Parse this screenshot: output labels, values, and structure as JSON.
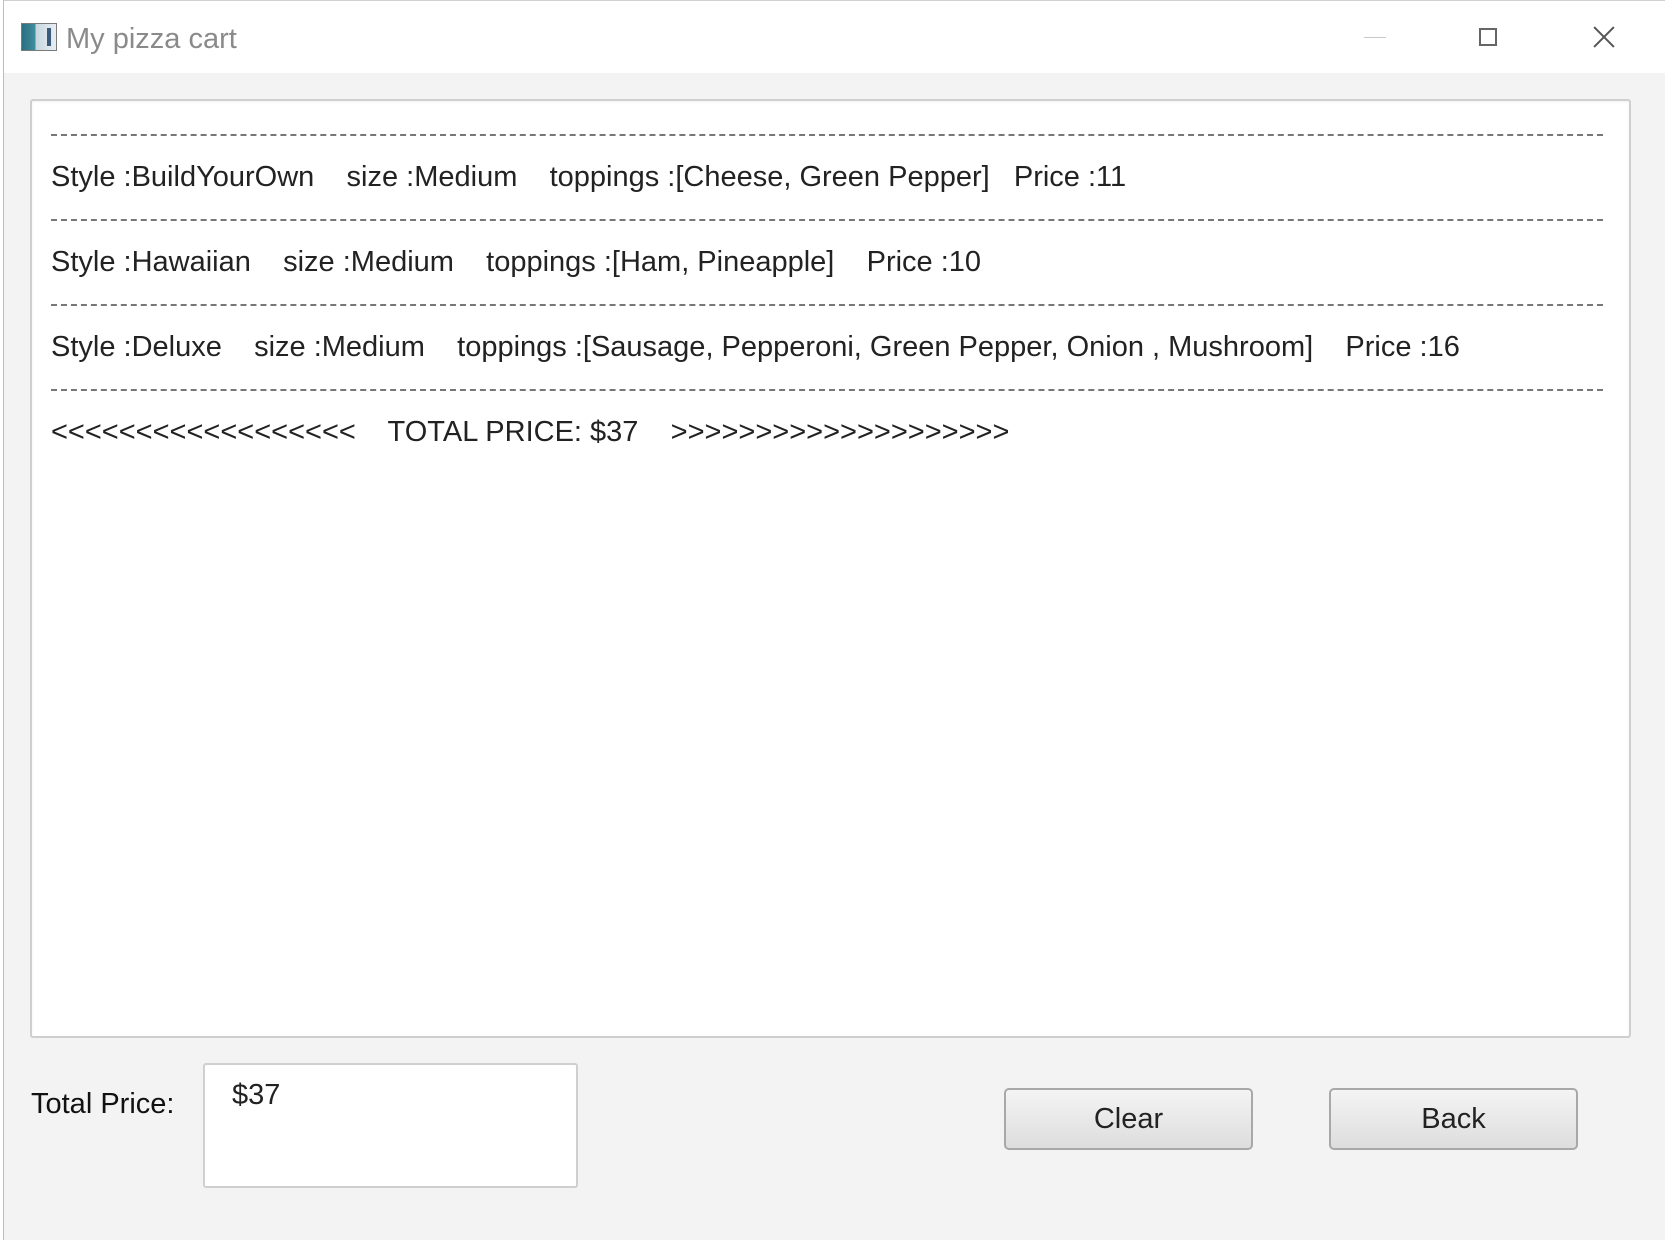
{
  "window": {
    "title": "My pizza cart"
  },
  "cart": {
    "items": [
      "Style :BuildYourOwn    size :Medium    toppings :[Cheese, Green Pepper]   Price :11",
      "Style :Hawaiian    size :Medium    toppings :[Ham, Pineapple]    Price :10",
      "Style :Deluxe    size :Medium    toppings :[Sausage, Pepperoni, Green Pepper, Onion , Mushroom]    Price :16"
    ],
    "total_line": "<<<<<<<<<<<<<<<<<<    TOTAL PRICE: $37    >>>>>>>>>>>>>>>>>>>>"
  },
  "footer": {
    "total_label": "Total Price:",
    "total_value": "$37",
    "clear_label": "Clear",
    "back_label": "Back"
  }
}
